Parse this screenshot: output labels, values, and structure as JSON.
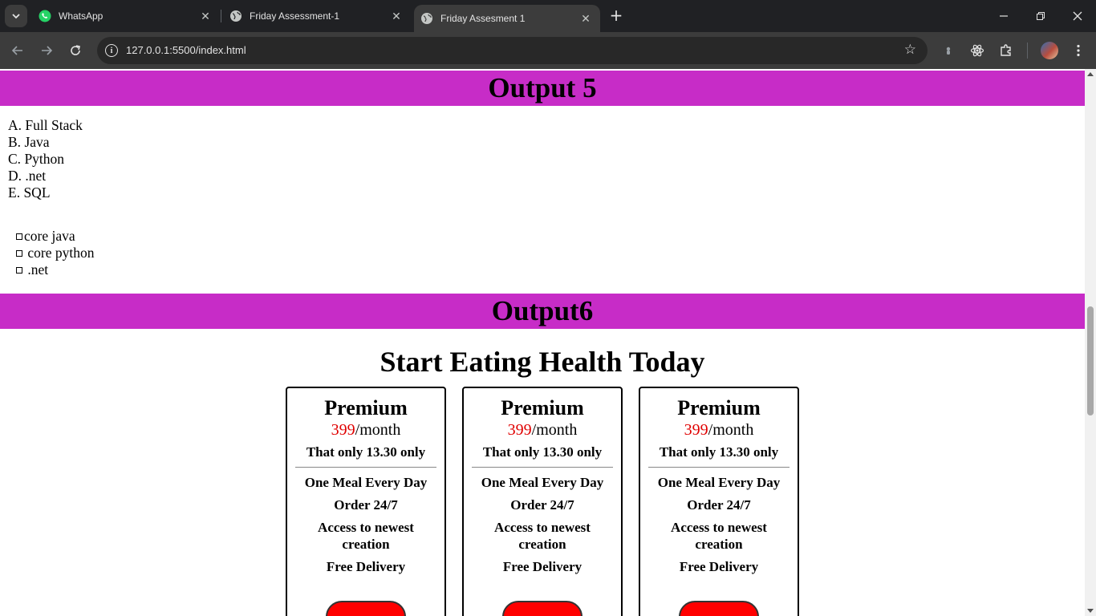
{
  "browser": {
    "tabs": [
      {
        "label": "WhatsApp",
        "icon": "whatsapp-icon"
      },
      {
        "label": "Friday Assessment-1",
        "icon": "globe-icon"
      },
      {
        "label": "Friday Assesment 1",
        "icon": "globe-icon",
        "active": true
      }
    ],
    "url": "127.0.0.1:5500/index.html"
  },
  "page": {
    "output5": {
      "heading": "Output 5",
      "alpha_list": [
        {
          "marker": "A.",
          "text": "Full Stack"
        },
        {
          "marker": "B.",
          "text": "Java"
        },
        {
          "marker": "C.",
          "text": "Python"
        },
        {
          "marker": "D.",
          "text": ".net"
        },
        {
          "marker": "E.",
          "text": "SQL"
        }
      ],
      "square_list": [
        "core java",
        " core python",
        " .net"
      ]
    },
    "output6": {
      "heading": "Output6",
      "title": "Start Eating Health Today",
      "cards": [
        {
          "plan": "Premium",
          "price": "399",
          "period": "/month",
          "note": "That only 13.30 only",
          "features": [
            "One Meal Every Day",
            "Order 24/7",
            "Access to newest creation",
            "Free Delivery"
          ]
        },
        {
          "plan": "Premium",
          "price": "399",
          "period": "/month",
          "note": "That only 13.30 only",
          "features": [
            "One Meal Every Day",
            "Order 24/7",
            "Access to newest creation",
            "Free Delivery"
          ]
        },
        {
          "plan": "Premium",
          "price": "399",
          "period": "/month",
          "note": "That only 13.30 only",
          "features": [
            "One Meal Every Day",
            "Order 24/7",
            "Access to newest creation",
            "Free Delivery"
          ]
        }
      ]
    }
  },
  "colors": {
    "band": "#c72cc7",
    "price": "#e00000",
    "button": "#ff0000"
  }
}
